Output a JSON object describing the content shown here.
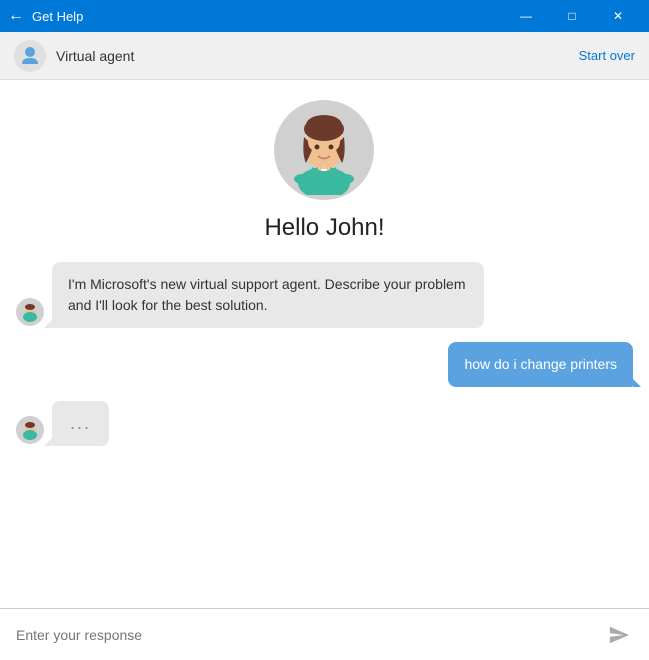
{
  "titlebar": {
    "title": "Get Help",
    "back_icon": "←",
    "minimize_icon": "—",
    "maximize_icon": "□",
    "close_icon": "✕"
  },
  "agent_header": {
    "agent_name": "Virtual agent",
    "start_over_label": "Start over"
  },
  "chat": {
    "greeting": "Hello John!",
    "messages": [
      {
        "type": "agent",
        "text": "I'm Microsoft's new virtual support agent. Describe your problem and I'll look for the best solution."
      },
      {
        "type": "user",
        "text": "how do i change printers"
      },
      {
        "type": "typing",
        "text": "..."
      }
    ]
  },
  "input": {
    "placeholder": "Enter your response"
  },
  "colors": {
    "titlebar_bg": "#0078d7",
    "user_bubble": "#5ba3e0",
    "agent_bubble": "#e8e8e8",
    "start_over": "#0078d7"
  }
}
